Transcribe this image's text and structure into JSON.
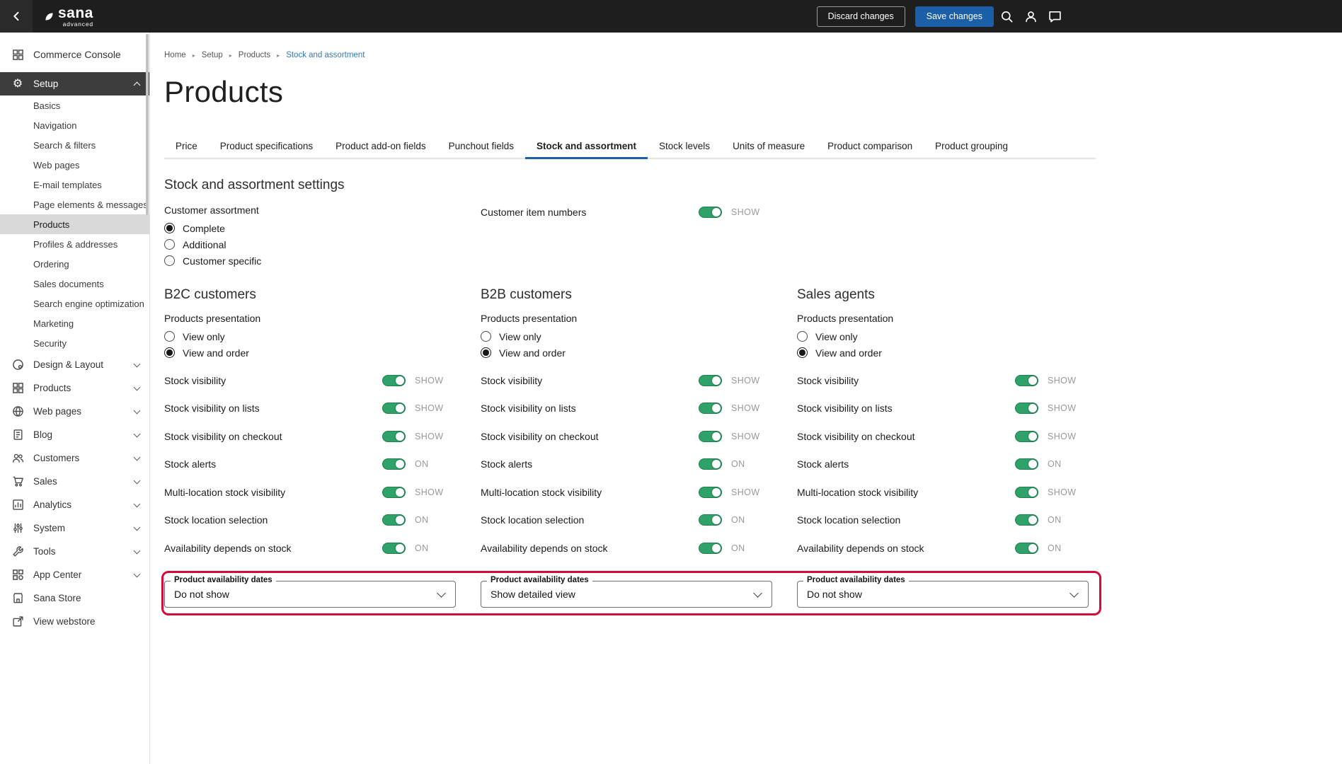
{
  "topbar": {
    "logo": "sana",
    "logo_sub": "advanced",
    "discard": "Discard changes",
    "save": "Save changes"
  },
  "icons": {
    "gear": "⚙",
    "breadcrumb_separator": "▸"
  },
  "sidebar": {
    "console": "Commerce Console",
    "setup": "Setup",
    "setup_children": [
      "Basics",
      "Navigation",
      "Search & filters",
      "Web pages",
      "E-mail templates",
      "Page elements & messages",
      "Products",
      "Profiles & addresses",
      "Ordering",
      "Sales documents",
      "Search engine optimization",
      "Marketing",
      "Security"
    ],
    "selected_child": "Products",
    "sections": [
      "Design & Layout",
      "Products",
      "Web pages",
      "Blog",
      "Customers",
      "Sales",
      "Analytics",
      "System",
      "Tools",
      "App Center"
    ],
    "footer": [
      "Sana Store",
      "View webstore"
    ]
  },
  "breadcrumb": [
    "Home",
    "Setup",
    "Products",
    "Stock and assortment"
  ],
  "tabs": [
    "Price",
    "Product specifications",
    "Product add-on fields",
    "Punchout fields",
    "Stock and assortment",
    "Stock levels",
    "Units of measure",
    "Product comparison",
    "Product grouping"
  ],
  "active_tab": "Stock and assortment",
  "content": {
    "title": "Products",
    "section_title": "Stock and assortment settings",
    "customer_assortment": {
      "label": "Customer assortment",
      "options": [
        "Complete",
        "Additional",
        "Customer specific"
      ],
      "selected": "Complete"
    },
    "customer_item_numbers": {
      "label": "Customer item numbers",
      "state": "SHOW"
    },
    "presentation": {
      "label": "Products presentation",
      "options": [
        "View only",
        "View and order"
      ]
    },
    "columns": [
      {
        "name": "B2C customers",
        "presentation_selected": "View and order",
        "toggles": [
          {
            "label": "Stock visibility",
            "state": "SHOW"
          },
          {
            "label": "Stock visibility on lists",
            "state": "SHOW"
          },
          {
            "label": "Stock visibility on checkout",
            "state": "SHOW"
          },
          {
            "label": "Stock alerts",
            "state": "ON"
          },
          {
            "label": "Multi-location stock visibility",
            "state": "SHOW"
          },
          {
            "label": "Stock location selection",
            "state": "ON"
          },
          {
            "label": "Availability depends on stock",
            "state": "ON"
          }
        ],
        "availability_dates": {
          "label": "Product availability dates",
          "value": "Do not show"
        }
      },
      {
        "name": "B2B customers",
        "presentation_selected": "View and order",
        "toggles": [
          {
            "label": "Stock visibility",
            "state": "SHOW"
          },
          {
            "label": "Stock visibility on lists",
            "state": "SHOW"
          },
          {
            "label": "Stock visibility on checkout",
            "state": "SHOW"
          },
          {
            "label": "Stock alerts",
            "state": "ON"
          },
          {
            "label": "Multi-location stock visibility",
            "state": "SHOW"
          },
          {
            "label": "Stock location selection",
            "state": "ON"
          },
          {
            "label": "Availability depends on stock",
            "state": "ON"
          }
        ],
        "availability_dates": {
          "label": "Product availability dates",
          "value": "Show detailed view"
        }
      },
      {
        "name": "Sales agents",
        "presentation_selected": "View and order",
        "toggles": [
          {
            "label": "Stock visibility",
            "state": "SHOW"
          },
          {
            "label": "Stock visibility on lists",
            "state": "SHOW"
          },
          {
            "label": "Stock visibility on checkout",
            "state": "SHOW"
          },
          {
            "label": "Stock alerts",
            "state": "ON"
          },
          {
            "label": "Multi-location stock visibility",
            "state": "SHOW"
          },
          {
            "label": "Stock location selection",
            "state": "ON"
          },
          {
            "label": "Availability depends on stock",
            "state": "ON"
          }
        ],
        "availability_dates": {
          "label": "Product availability dates",
          "value": "Do not show"
        }
      }
    ]
  },
  "colors": {
    "topbar_bg": "#1E1E1E",
    "accent_blue": "#1B5FA8",
    "link_blue": "#3179B8",
    "toggle_green": "#2EA269",
    "annotation_red": "#D60B3C"
  }
}
